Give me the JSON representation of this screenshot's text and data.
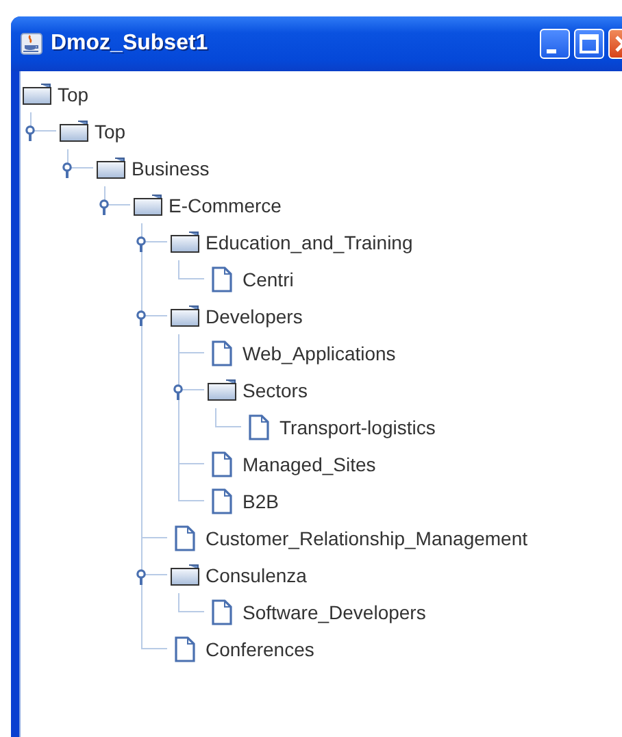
{
  "window": {
    "title": "Dmoz_Subset1"
  },
  "tree": {
    "label": "Top",
    "kind": "folder",
    "children": [
      {
        "label": "Top",
        "kind": "folder",
        "expanded": true,
        "children": [
          {
            "label": "Business",
            "kind": "folder",
            "expanded": true,
            "children": [
              {
                "label": "E-Commerce",
                "kind": "folder",
                "expanded": true,
                "children": [
                  {
                    "label": "Education_and_Training",
                    "kind": "folder",
                    "expanded": true,
                    "children": [
                      {
                        "label": "Centri",
                        "kind": "file"
                      }
                    ]
                  },
                  {
                    "label": "Developers",
                    "kind": "folder",
                    "expanded": true,
                    "children": [
                      {
                        "label": "Web_Applications",
                        "kind": "file"
                      },
                      {
                        "label": "Sectors",
                        "kind": "folder",
                        "expanded": true,
                        "children": [
                          {
                            "label": "Transport-logistics",
                            "kind": "file"
                          }
                        ]
                      },
                      {
                        "label": "Managed_Sites",
                        "kind": "file"
                      },
                      {
                        "label": "B2B",
                        "kind": "file"
                      }
                    ]
                  },
                  {
                    "label": "Customer_Relationship_Management",
                    "kind": "file"
                  },
                  {
                    "label": "Consulenza",
                    "kind": "folder",
                    "expanded": true,
                    "children": [
                      {
                        "label": "Software_Developers",
                        "kind": "file"
                      }
                    ]
                  },
                  {
                    "label": "Conferences",
                    "kind": "file"
                  }
                ]
              }
            ]
          }
        ]
      }
    ]
  }
}
